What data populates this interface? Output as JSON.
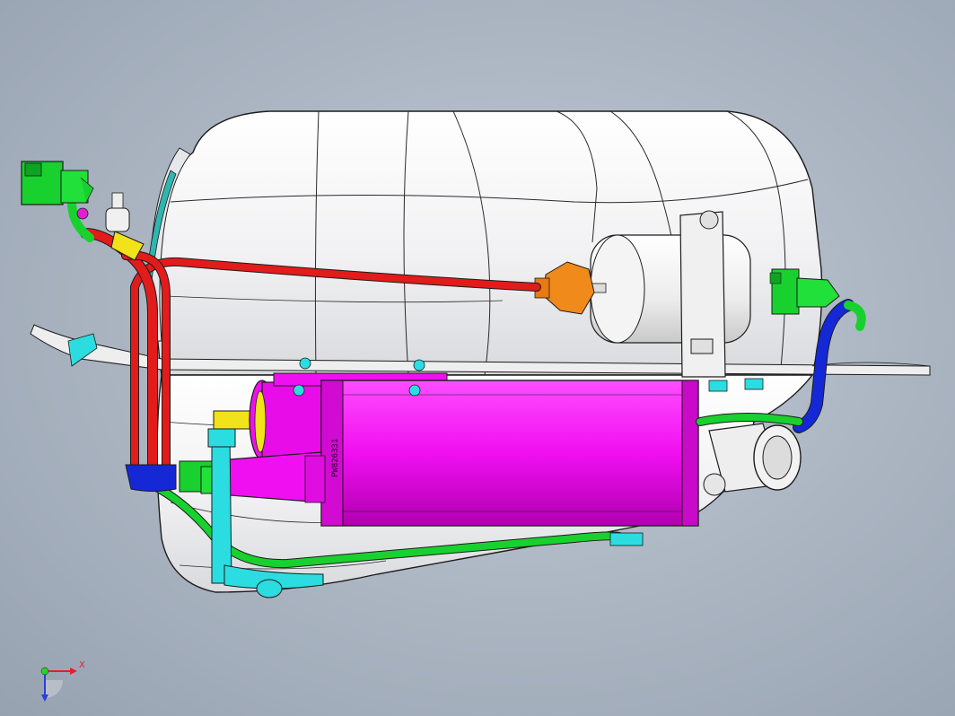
{
  "viewport": {
    "background_color": "#aab4c1"
  },
  "part_labels": {
    "canister_marking": "PW826331"
  },
  "triad": {
    "x_label": "X",
    "y_label": "Y"
  },
  "colors": {
    "tank": "#f2f2f4",
    "tank_edges": "#1c1c1c",
    "red_line": "#e21b1b",
    "green_line": "#18d12e",
    "blue_line": "#1428d6",
    "canister": "#f20ef2",
    "cyan_parts": "#2bdde0",
    "fuel_filter": "#eeeeee",
    "brass_fitting": "#f08a1a",
    "yellow_fitting": "#f2e21a"
  }
}
